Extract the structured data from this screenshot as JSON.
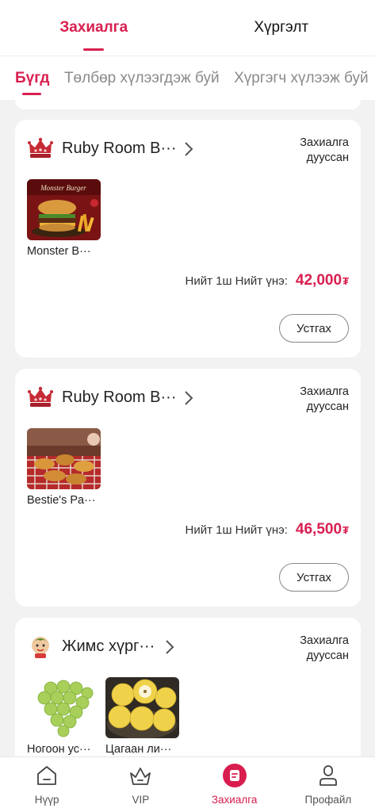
{
  "top_tabs": [
    {
      "label": "Захиалга",
      "active": true
    },
    {
      "label": "Хүргэлт",
      "active": false
    }
  ],
  "filters": [
    {
      "label": "Бүгд",
      "active": true
    },
    {
      "label": "Төлбөр хүлээгдэж буй",
      "active": false
    },
    {
      "label": "Хүргэгч хүлээж буй",
      "active": false
    },
    {
      "label": "Хү",
      "active": false
    }
  ],
  "orders": [
    {
      "store": "Ruby Room B···",
      "store_icon": "crown-icon",
      "status": "Захиалга дууссан",
      "products": [
        {
          "name": "Monster B···",
          "image": "burger-photo"
        }
      ],
      "total_label": "Нийт 1ш Нийт үнэ:",
      "total_price": "42,000",
      "currency": "₮",
      "delete_label": "Устгах"
    },
    {
      "store": "Ruby Room B···",
      "store_icon": "crown-icon",
      "status": "Захиалга дууссан",
      "products": [
        {
          "name": "Bestie's Pa···",
          "image": "party-food-photo"
        }
      ],
      "total_label": "Нийт 1ш Нийт үнэ:",
      "total_price": "46,500",
      "currency": "₮",
      "delete_label": "Устгах"
    },
    {
      "store": "Жимс хүрг···",
      "store_icon": "fruit-mascot-icon",
      "status": "Захиалга дууссан",
      "products": [
        {
          "name": "Ногоон ус···",
          "image": "green-grapes-photo"
        },
        {
          "name": "Цагаан ли···",
          "image": "pears-photo"
        }
      ]
    }
  ],
  "bottom_nav": [
    {
      "label": "Нүүр",
      "icon": "home-icon",
      "active": false
    },
    {
      "label": "VIP",
      "icon": "crown-icon",
      "active": false
    },
    {
      "label": "Захиалга",
      "icon": "orders-icon",
      "active": true
    },
    {
      "label": "Профайл",
      "icon": "profile-icon",
      "active": false
    }
  ],
  "colors": {
    "accent": "#d81e4f",
    "background": "#f2f2f2",
    "card": "#ffffff"
  }
}
